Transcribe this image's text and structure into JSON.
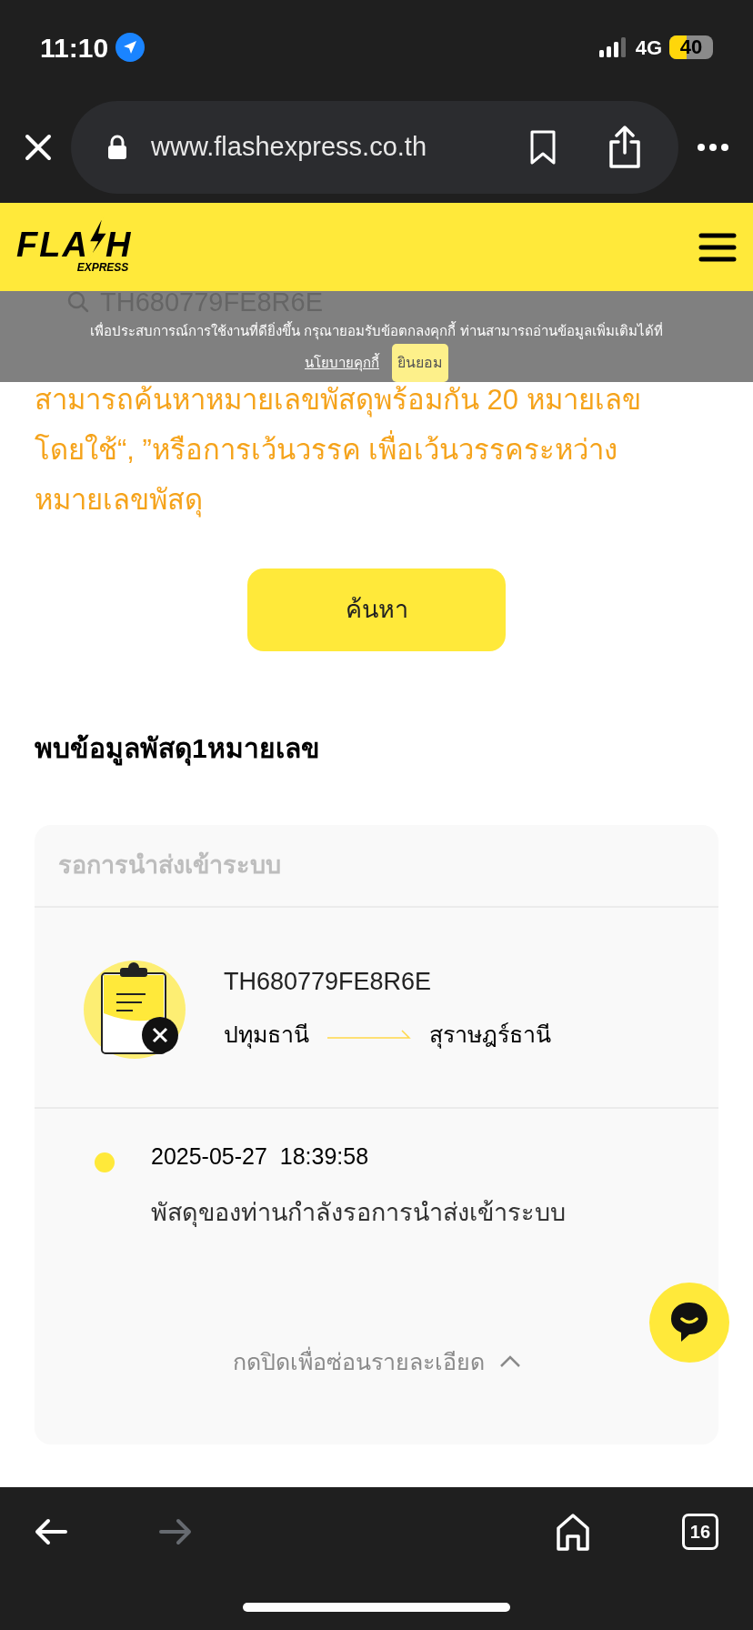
{
  "status_bar": {
    "time": "11:10",
    "network": "4G",
    "battery": "40"
  },
  "browser": {
    "url": "www.flashexpress.co.th"
  },
  "header": {
    "logo": {
      "left": "FLA",
      "right": "H",
      "sub": "EXPRESS"
    }
  },
  "search": {
    "value": "TH680779FE8R6E",
    "hint": "สามารถค้นหาหมายเลขพัสดุพร้อมกัน 20 หมายเลข โดยใช้“, ”หรือการเว้นวรรค เพื่อเว้นวรรคระหว่างหมายเลขพัสดุ",
    "button": "ค้นหา"
  },
  "cookie_banner": {
    "text": "เพื่อประสบการณ์การใช้งานที่ดียิ่งขึ้น กรุณายอมรับข้อตกลงคุกกี้ ท่านสามารถอ่านข้อมูลเพิ่มเติมได้ที่",
    "link": "นโยบายคุกกี้",
    "accept": "ยินยอม"
  },
  "result": {
    "heading": "พบข้อมูลพัสดุ1หมายเลข",
    "status": "รอการนำส่งเข้าระบบ",
    "tracking_number": "TH680779FE8R6E",
    "origin": "ปทุมธานี",
    "destination": "สุราษฎร์ธานี",
    "events": [
      {
        "time": "2025-05-27  18:39:58",
        "description": "พัสดุของท่านกำลังรอการนำส่งเข้าระบบ"
      }
    ],
    "toggle": {
      "label": "กดปิดเพื่อซ่อนรายละเอียด",
      "expanded": true
    }
  },
  "toolbar": {
    "tab_count": "16",
    "forward_disabled": true
  }
}
